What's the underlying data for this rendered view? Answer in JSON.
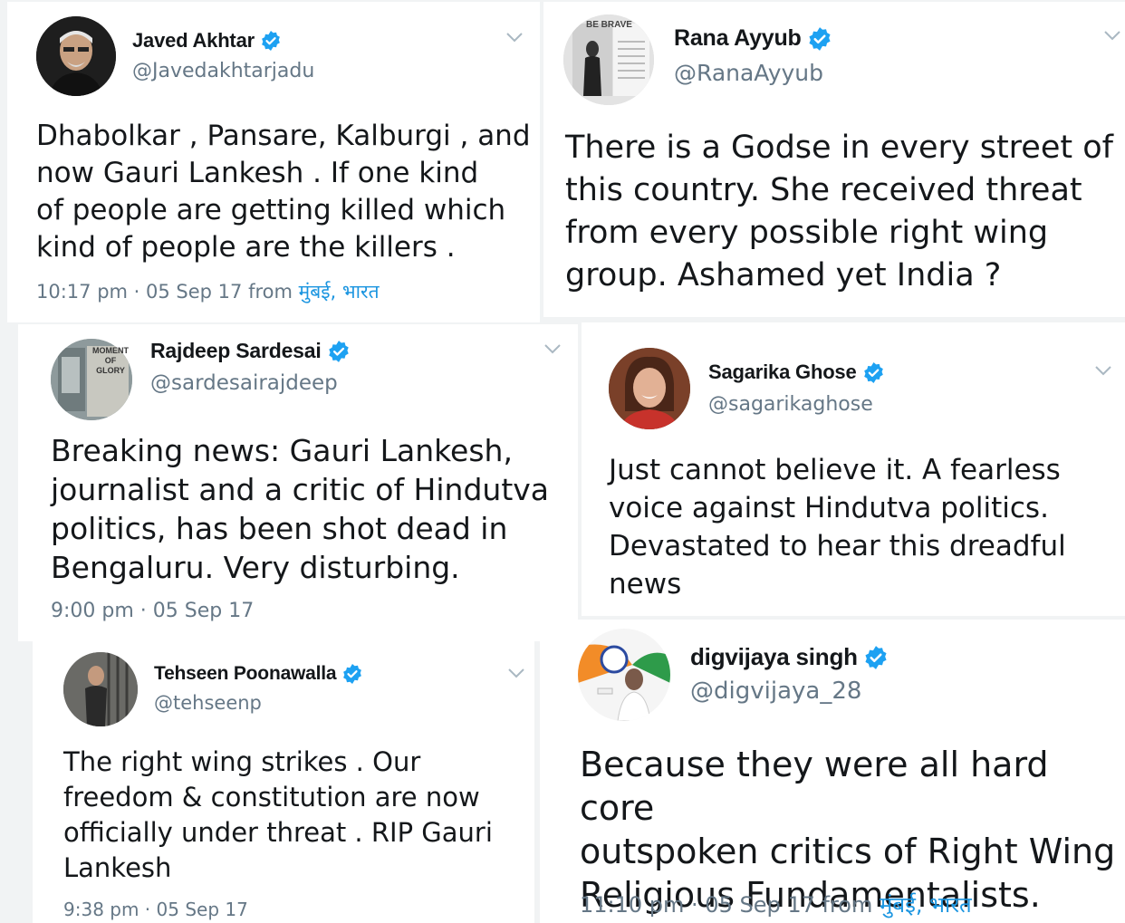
{
  "tweets": [
    {
      "name": "Javed Akhtar",
      "handle": "@Javedakhtarjadu",
      "text": "Dhabolkar , Pansare, Kalburgi , and\nnow Gauri Lankesh . If one kind\nof people are getting killed which\nkind of people are the killers .",
      "time": "10:17 pm · 05 Sep 17",
      "from": "from",
      "location": "मुंबई, भारत",
      "avatar_icon": "person-photo"
    },
    {
      "name": "Rana Ayyub",
      "handle": "@RanaAyyub",
      "text": "There is a Godse in every street of\nthis country. She received threat\nfrom every possible right wing\ngroup. Ashamed yet India ?",
      "avatar_label": "BE BRAVE",
      "avatar_icon": "magazine-photo"
    },
    {
      "name": "Rajdeep Sardesai",
      "handle": "@sardesairajdeep",
      "text": "Breaking news: Gauri Lankesh,\njournalist and a critic of Hindutva\npolitics, has been shot dead in\nBengaluru. Very disturbing.",
      "time": "9:00 pm · 05 Sep 17",
      "avatar_label_1": "MOMENT",
      "avatar_label_2": "OF",
      "avatar_label_3": "GLORY",
      "avatar_icon": "book-cover-photo"
    },
    {
      "name": "Sagarika Ghose",
      "handle": "@sagarikaghose",
      "text": "Just cannot believe it. A fearless\nvoice against Hindutva politics.\nDevastated to hear this dreadful\nnews",
      "avatar_icon": "person-photo"
    },
    {
      "name": "Tehseen Poonawalla",
      "handle": "@tehseenp",
      "text": "The right wing strikes . Our\nfreedom & constitution are now\nofficially under threat . RIP Gauri\nLankesh",
      "time": "9:38 pm · 05 Sep 17",
      "avatar_icon": "person-photo"
    },
    {
      "name": "digvijaya singh",
      "handle": "@digvijaya_28",
      "text": "Because they were all hard core\noutspoken critics of Right Wing\nReligious Fundamentalists.",
      "time": "11:10 pm · 05 Sep 17",
      "from": "from",
      "location": "मुंबई, भारत",
      "avatar_icon": "person-photo"
    }
  ],
  "colors": {
    "verified": "#1da1f2",
    "link": "#1b95e0",
    "muted": "#657786",
    "text": "#14171a"
  }
}
